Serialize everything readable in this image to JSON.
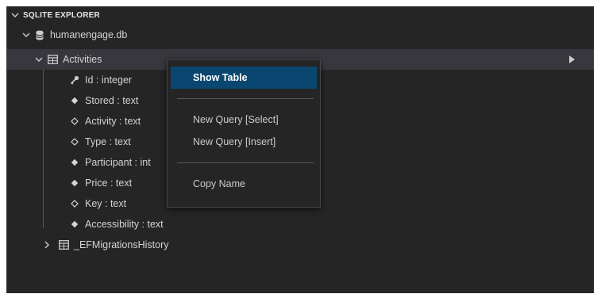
{
  "explorer": {
    "header": "SQLITE EXPLORER",
    "database": {
      "name": "humanengage.db",
      "icon": "database-icon"
    },
    "tables": [
      {
        "name": "Activities",
        "icon": "table-icon",
        "expanded": true,
        "columns": [
          {
            "label": "Id : integer",
            "icon": "key-icon"
          },
          {
            "label": "Stored : text",
            "icon": "filled-diamond-icon"
          },
          {
            "label": "Activity : text",
            "icon": "hollow-diamond-icon"
          },
          {
            "label": "Type : text",
            "icon": "hollow-diamond-icon"
          },
          {
            "label": "Participant : int",
            "icon": "filled-diamond-icon"
          },
          {
            "label": "Price : text",
            "icon": "filled-diamond-icon"
          },
          {
            "label": "Key : text",
            "icon": "hollow-diamond-icon"
          },
          {
            "label": "Accessibility : text",
            "icon": "filled-diamond-icon"
          }
        ]
      },
      {
        "name": "_EFMigrationsHistory",
        "icon": "table-icon",
        "expanded": false
      }
    ]
  },
  "context_menu": {
    "items": [
      {
        "label": "Show Table",
        "highlighted": true
      },
      {
        "label": "New Query [Select]"
      },
      {
        "label": "New Query [Insert]"
      },
      {
        "label": "Copy Name"
      }
    ]
  },
  "colors": {
    "panel_bg": "#252526",
    "selected_row": "#37373d",
    "menu_highlight": "#094771",
    "text": "#d4d4d4"
  }
}
